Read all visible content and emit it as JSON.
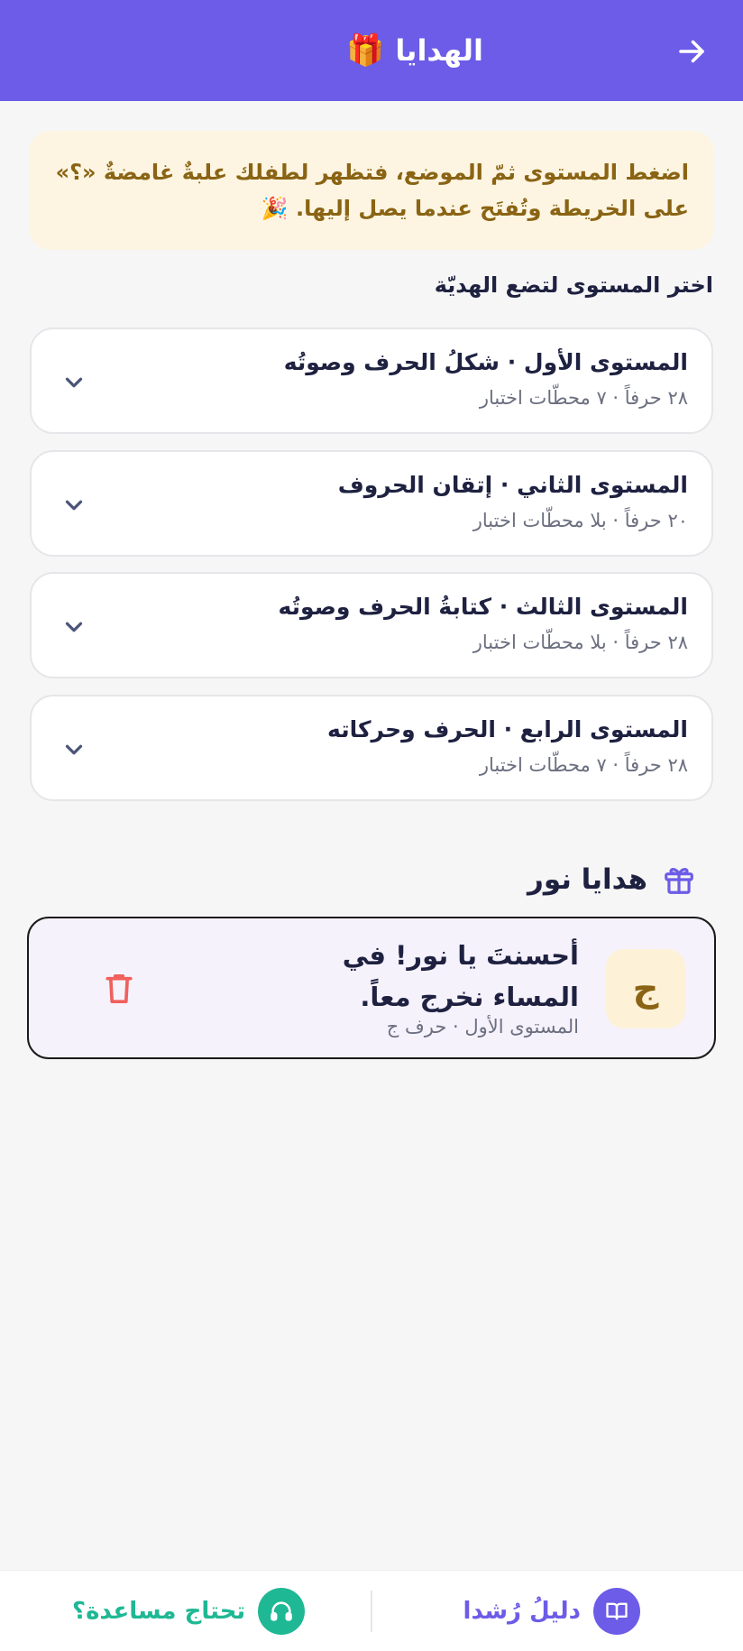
{
  "header": {
    "title": "الهدايا",
    "title_emoji": "🎁",
    "back_icon": "arrow-right-icon",
    "background": "#6c5ce7"
  },
  "banner": {
    "text": "اضغط المستوى ثمّ الموضع، فتظهر لطفلك علبةٌ غامضةٌ «؟» على الخريطة وتُفتَح عندما يصل إليها. 🎉"
  },
  "levels_section": {
    "title": "اختر المستوى لتضع الهديّة",
    "levels": [
      {
        "title": "المستوى الأول · شكلُ الحرف وصوتُه",
        "subtitle": "٢٨ حرفاً · ٧ محطّات اختبار"
      },
      {
        "title": "المستوى الثاني · إتقان الحروف",
        "subtitle": "٢٠ حرفاً · بلا محطّات اختبار"
      },
      {
        "title": "المستوى الثالث · كتابةُ الحرف وصوتُه",
        "subtitle": "٢٨ حرفاً · بلا محطّات اختبار"
      },
      {
        "title": "المستوى الرابع · الحرف وحركاته",
        "subtitle": "٢٨ حرفاً · ٧ محطّات اختبار"
      }
    ]
  },
  "gifts_section": {
    "title": "هدايا نور",
    "icon": "gift-box-icon",
    "items": [
      {
        "letter": "ج",
        "message": "أحسنتَ يا نور! في المساء نخرج معاً.",
        "meta": "المستوى الأول · حرف ج"
      }
    ]
  },
  "bottom_bar": {
    "guide_label": "دليلُ رُشدا",
    "help_label": "تحتاج مساعدة؟",
    "guide_color": "#6c5ce7",
    "help_color": "#1fb894"
  }
}
